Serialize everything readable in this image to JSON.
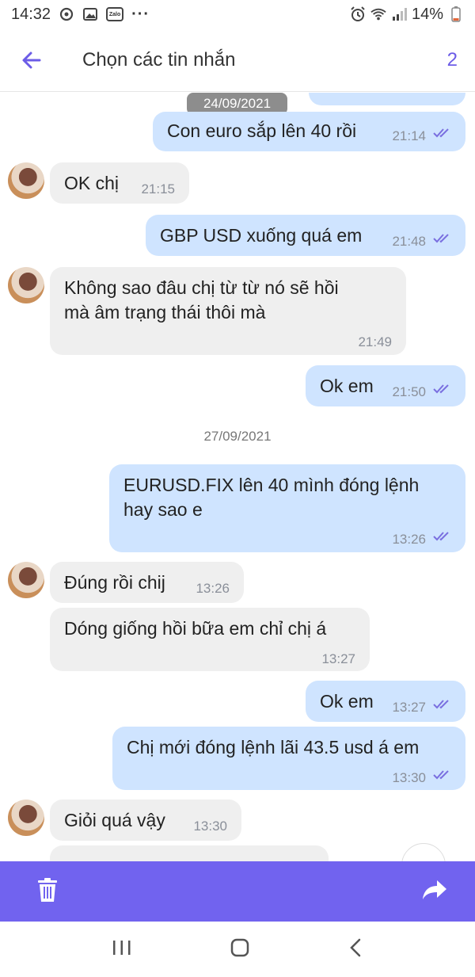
{
  "status_bar": {
    "time": "14:32",
    "battery": "14%"
  },
  "header": {
    "title": "Chọn các tin nhắn",
    "selected_count": "2"
  },
  "dates": [
    "24/09/2021",
    "27/09/2021"
  ],
  "messages": [
    {
      "text": "Con euro sắp lên 40 rồi",
      "time": "21:14"
    },
    {
      "text": "OK chị",
      "time": "21:15"
    },
    {
      "text": "GBP USD xuống quá em",
      "time": "21:48"
    },
    {
      "text_line1": "Không sao đâu chị từ từ nó sẽ hồi",
      "text_line2": "mà âm trạng thái thôi mà",
      "time": "21:49"
    },
    {
      "text": "Ok em",
      "time": "21:50"
    },
    {
      "text_line1": "EURUSD.FIX lên 40 mình đóng lệnh",
      "text_line2": "hay sao e",
      "time": "13:26"
    },
    {
      "text": "Đúng rồi chij",
      "time": "13:26"
    },
    {
      "text": "Dóng giống hồi bữa em chỉ chị á",
      "time": "13:27"
    },
    {
      "text": "Ok em",
      "time": "13:27"
    },
    {
      "text": "Chị mới đóng lệnh lãi 43.5 usd á em",
      "time": "13:30"
    },
    {
      "text": "Giỏi quá vậy",
      "time": "13:30"
    }
  ],
  "icons": {
    "back": "arrow-left-icon",
    "delete": "trash-icon",
    "forward": "share-arrow-icon",
    "read_receipt": "double-check-icon"
  },
  "colors": {
    "accent": "#7163ef",
    "outgoing_bubble": "#cfe4ff",
    "incoming_bubble": "#efefef",
    "read_check": "#7a6fe0"
  }
}
